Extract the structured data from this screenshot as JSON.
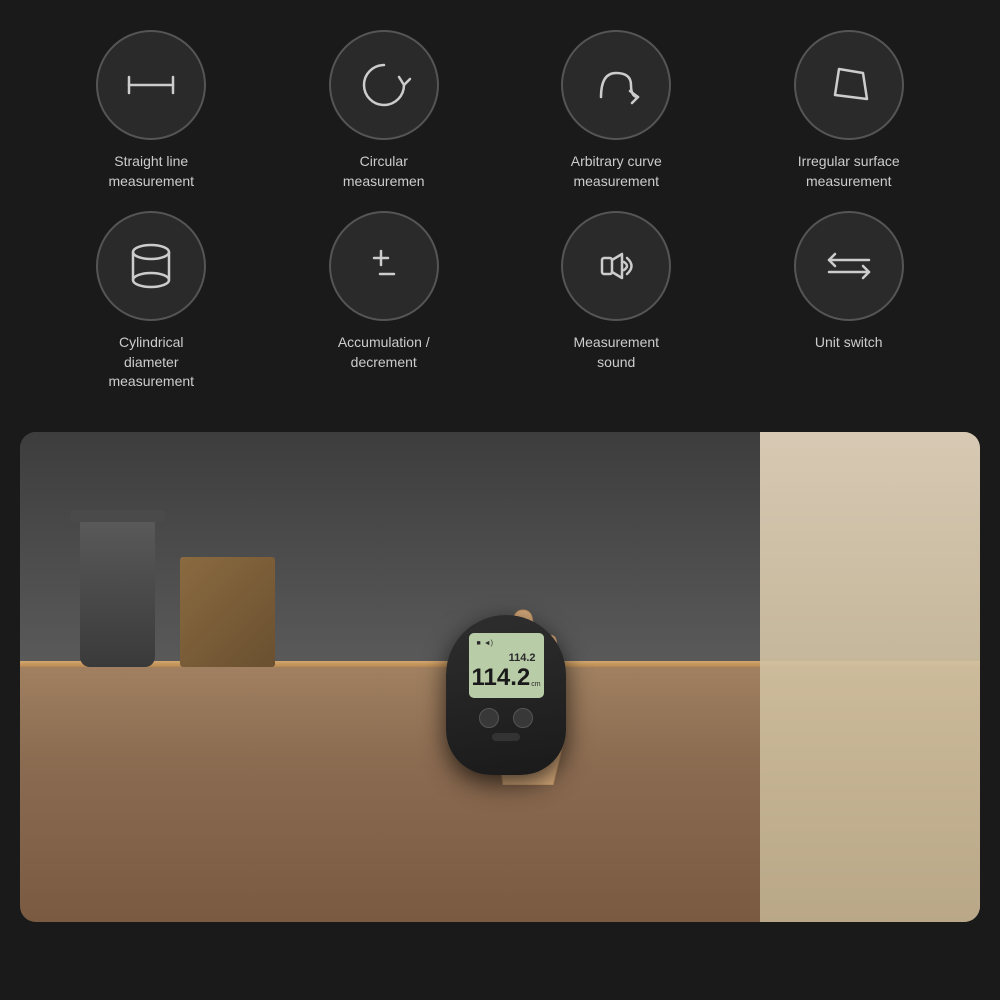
{
  "colors": {
    "background": "#1a1a1a",
    "circle_bg": "#2a2a2a",
    "circle_border": "#555555",
    "text": "#cccccc"
  },
  "features": {
    "row1": [
      {
        "id": "straight-line",
        "label": "Straight line\nmeasurement",
        "icon": "ruler-horizontal"
      },
      {
        "id": "circular",
        "label": "Circular\nmeasuremen",
        "icon": "rotate-circle"
      },
      {
        "id": "arbitrary-curve",
        "label": "Arbitrary curve\nmeasurement",
        "icon": "curve-arrow"
      },
      {
        "id": "irregular-surface",
        "label": "Irregular surface\nmeasurement",
        "icon": "irregular-shape"
      }
    ],
    "row2": [
      {
        "id": "cylindrical",
        "label": "Cylindrical\ndiameter\nmeasurement",
        "icon": "cylinder"
      },
      {
        "id": "accumulation",
        "label": "Accumulation /\ndecrement",
        "icon": "plus-minus"
      },
      {
        "id": "sound",
        "label": "Measurement\nsound",
        "icon": "volume"
      },
      {
        "id": "unit-switch",
        "label": "Unit switch",
        "icon": "switch-arrows"
      }
    ]
  },
  "device": {
    "display_small": "114.2",
    "display_large": "114.2",
    "unit": "cm"
  }
}
